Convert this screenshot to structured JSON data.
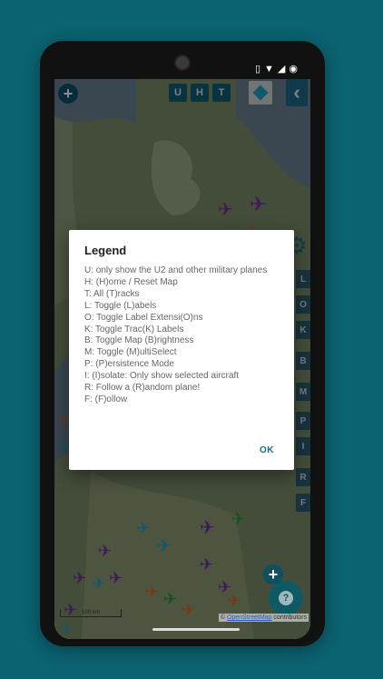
{
  "status_bar": {
    "icons": [
      "vibrate-icon",
      "wifi-icon",
      "signal-icon",
      "battery-icon"
    ]
  },
  "toolbar": {
    "buttons": [
      "U",
      "H",
      "T"
    ],
    "layers_icon": "layers-icon",
    "back_icon": "chevron-left-icon",
    "zoom_in_icon": "plus-icon"
  },
  "side_keys": [
    "L",
    "O",
    "K",
    "B",
    "M",
    "P",
    "I",
    "R",
    "F"
  ],
  "dialog": {
    "title": "Legend",
    "items": [
      "U: only show the U2 and other military planes",
      "H: (H)ome / Reset Map",
      "T: All (T)racks",
      "L: Toggle (L)abels",
      "O: Toggle Label Extensi(O)ns",
      "K: Toggle Trac(K) Labels",
      "B: Toggle Map (B)rightness",
      "M: Toggle (M)ultiSelect",
      "P: (P)ersistence Mode",
      "I: (I)solate: Only show selected aircraft",
      "R: Follow a (R)andom plane!",
      "F: (F)ollow"
    ],
    "ok_label": "OK"
  },
  "map": {
    "scale_label": "100 km",
    "attribution_prefix": "©",
    "attribution_link": "OpenStreetMap",
    "attribution_suffix": "contributors"
  },
  "help_icon": "question-icon",
  "colors": {
    "background": "#0b6270",
    "accent": "#1d6a86",
    "plane_purple": "#7a2aa8",
    "plane_orange": "#e0661a",
    "plane_cyan": "#1aa3c9",
    "plane_green": "#1f9c3a"
  }
}
